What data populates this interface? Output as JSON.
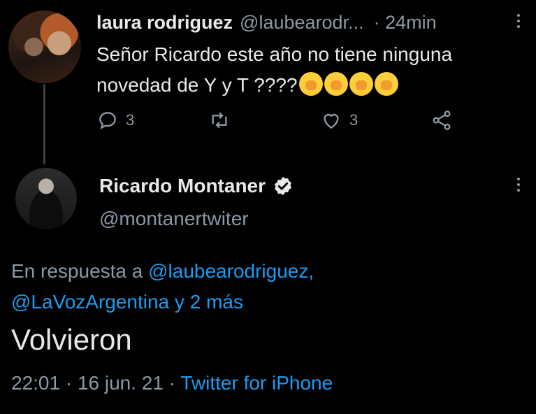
{
  "reply_tweet": {
    "display_name": "laura rodriguez",
    "handle": "@laubearodr...",
    "time": "· 24min",
    "text": "Señor Ricardo este año no tiene ninguna novedad de Y y T ????",
    "emoji_count": 4,
    "emoji_name": "face-with-hand-over-mouth",
    "reply_count": "3",
    "retweet_count": "",
    "like_count": "3"
  },
  "main_tweet": {
    "display_name": "Ricardo Montaner",
    "handle": "@montanertwiter",
    "reply_prefix": "En respuesta a ",
    "reply_user_1": "@laubearodriguez,",
    "reply_user_2": "@LaVozArgentina",
    "reply_suffix": " y 2 más",
    "text": "Volvieron",
    "time": "22:01 · 16 jun. 21 · ",
    "source": "Twitter for iPhone"
  },
  "colors": {
    "background": "#000000",
    "text": "#e7e9ea",
    "secondary": "#8b98a5",
    "link": "#1d9bf0"
  }
}
